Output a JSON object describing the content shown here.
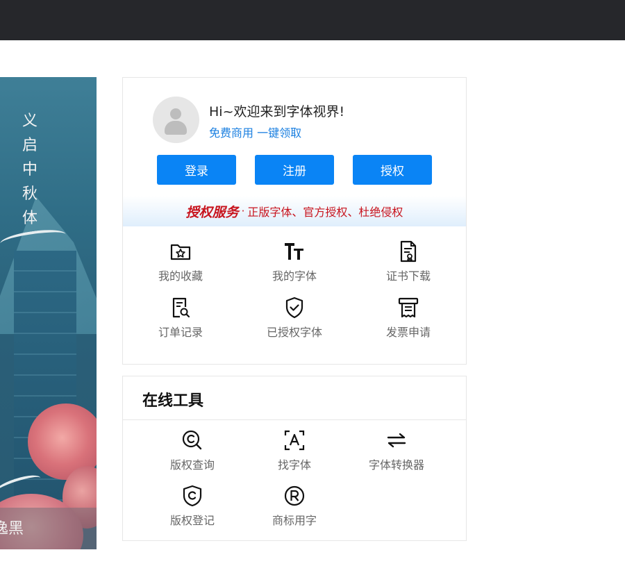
{
  "banner": {
    "vertical_title": [
      "义",
      "启",
      "中",
      "秋",
      "体"
    ],
    "caption": "逸黑"
  },
  "user": {
    "greeting": "Hi~欢迎来到字体视界!",
    "promo": "免费商用 一键领取"
  },
  "buttons": {
    "login": "登录",
    "register": "注册",
    "authorize": "授权"
  },
  "service": {
    "title": "授权服务",
    "separator": "·",
    "desc": "正版字体、官方授权、杜绝侵权"
  },
  "account_menu": [
    {
      "label": "我的收藏",
      "icon": "favorites-folder-icon"
    },
    {
      "label": "我的字体",
      "icon": "font-tt-icon"
    },
    {
      "label": "证书下载",
      "icon": "certificate-icon"
    },
    {
      "label": "订单记录",
      "icon": "order-search-icon"
    },
    {
      "label": "已授权字体",
      "icon": "shield-check-icon"
    },
    {
      "label": "发票申请",
      "icon": "invoice-icon"
    }
  ],
  "tools": {
    "title": "在线工具",
    "items": [
      {
        "label": "版权查询",
        "icon": "copyright-search-icon"
      },
      {
        "label": "找字体",
        "icon": "scan-text-icon"
      },
      {
        "label": "字体转换器",
        "icon": "convert-arrows-icon"
      },
      {
        "label": "版权登记",
        "icon": "copyright-shield-icon"
      },
      {
        "label": "商标用字",
        "icon": "registered-trademark-icon"
      }
    ]
  },
  "colors": {
    "primary": "#0a84f5",
    "service_red": "#c8141e",
    "topbar": "#26272b",
    "link_blue": "#1a7fe0"
  }
}
